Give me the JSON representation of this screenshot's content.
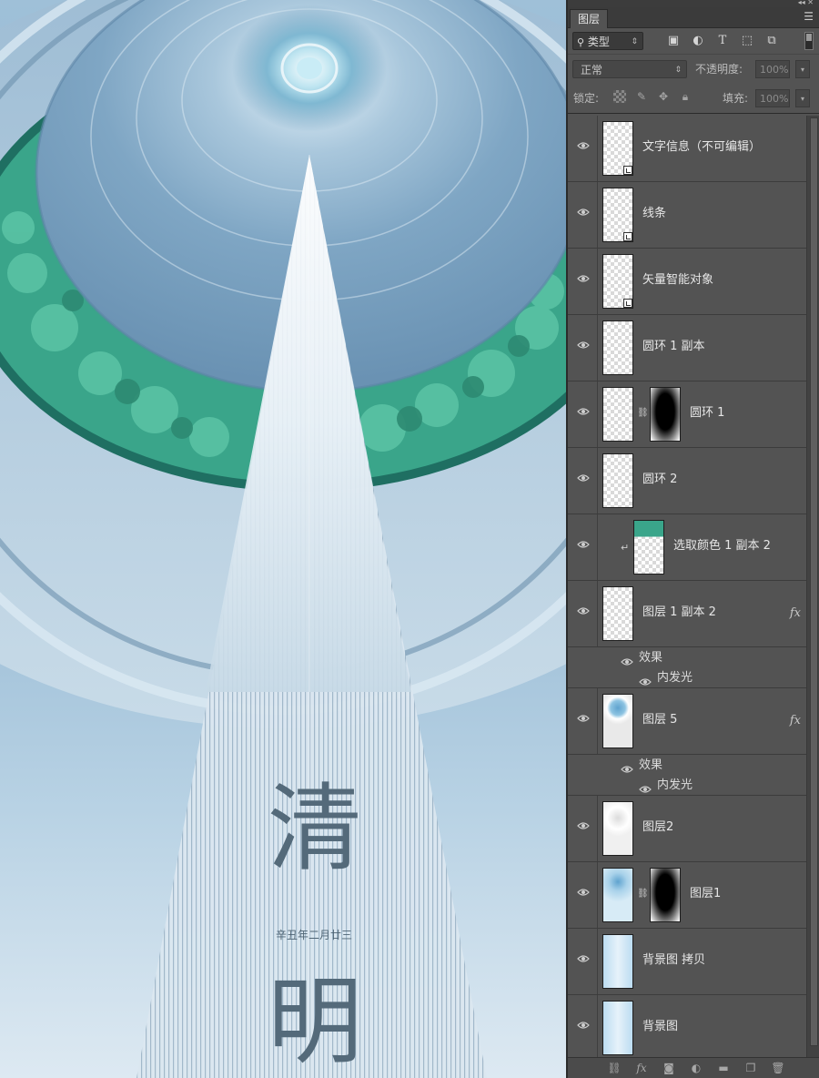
{
  "poster": {
    "title_char_1": "清",
    "title_char_2": "明",
    "date_line": "辛丑年二月廿三"
  },
  "layers_panel": {
    "tab_title": "图层",
    "menu_icon": "panel-menu-icon",
    "filter": {
      "kind_label": "类型",
      "icons": [
        "image-filter-icon",
        "adjustment-filter-icon",
        "type-filter-icon",
        "shape-filter-icon",
        "smart-object-filter-icon"
      ]
    },
    "blend_mode": "正常",
    "opacity_label": "不透明度:",
    "opacity_value": "100%",
    "lock_label": "锁定:",
    "fill_label": "填充:",
    "fill_value": "100%",
    "effects_label": "效果",
    "inner_glow_label": "内发光",
    "layers": [
      {
        "name": "文字信息（不可编辑）",
        "smart_object": true
      },
      {
        "name": "线条",
        "smart_object": true
      },
      {
        "name": "矢量智能对象",
        "smart_object": true
      },
      {
        "name": "圆环 1 副本"
      },
      {
        "name": "圆环 1",
        "has_mask": true
      },
      {
        "name": "圆环 2"
      },
      {
        "name": "选取颜色 1 副本 2",
        "clipped": true
      },
      {
        "name": "图层 1 副本 2",
        "fx": "fx",
        "effects": [
          "效果",
          "内发光"
        ]
      },
      {
        "name": "图层 5",
        "fx": "fx",
        "effects": [
          "效果",
          "内发光"
        ]
      },
      {
        "name": "图层2"
      },
      {
        "name": "图层1",
        "has_mask": true
      },
      {
        "name": "背景图 拷贝"
      },
      {
        "name": "背景图"
      }
    ],
    "fx_label": "fx"
  },
  "colors": {
    "panel_bg": "#535353",
    "canvas_blue": "#8cb2cf",
    "foliage_green": "#3aa58a",
    "title_text": "#546a7a"
  }
}
